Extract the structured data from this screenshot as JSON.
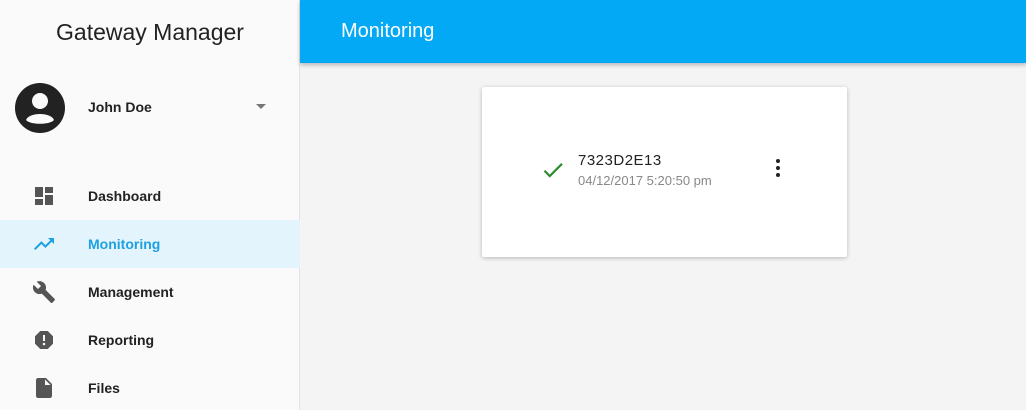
{
  "app": {
    "title": "Gateway Manager"
  },
  "user": {
    "name": "John Doe"
  },
  "nav": {
    "items": [
      {
        "label": "Dashboard",
        "icon": "dashboard-icon",
        "active": false
      },
      {
        "label": "Monitoring",
        "icon": "trending-up-icon",
        "active": true
      },
      {
        "label": "Management",
        "icon": "wrench-icon",
        "active": false
      },
      {
        "label": "Reporting",
        "icon": "report-icon",
        "active": false
      },
      {
        "label": "Files",
        "icon": "file-icon",
        "active": false
      }
    ]
  },
  "header": {
    "title": "Monitoring"
  },
  "device": {
    "id": "7323D2E13",
    "timestamp": "04/12/2017 5:20:50 pm",
    "status": "ok",
    "icon": "check-icon"
  },
  "colors": {
    "primary": "#03a9f4",
    "active_text": "#1da1e0",
    "active_bg": "#e4f4fc",
    "status_ok": "#2e8b2e"
  }
}
